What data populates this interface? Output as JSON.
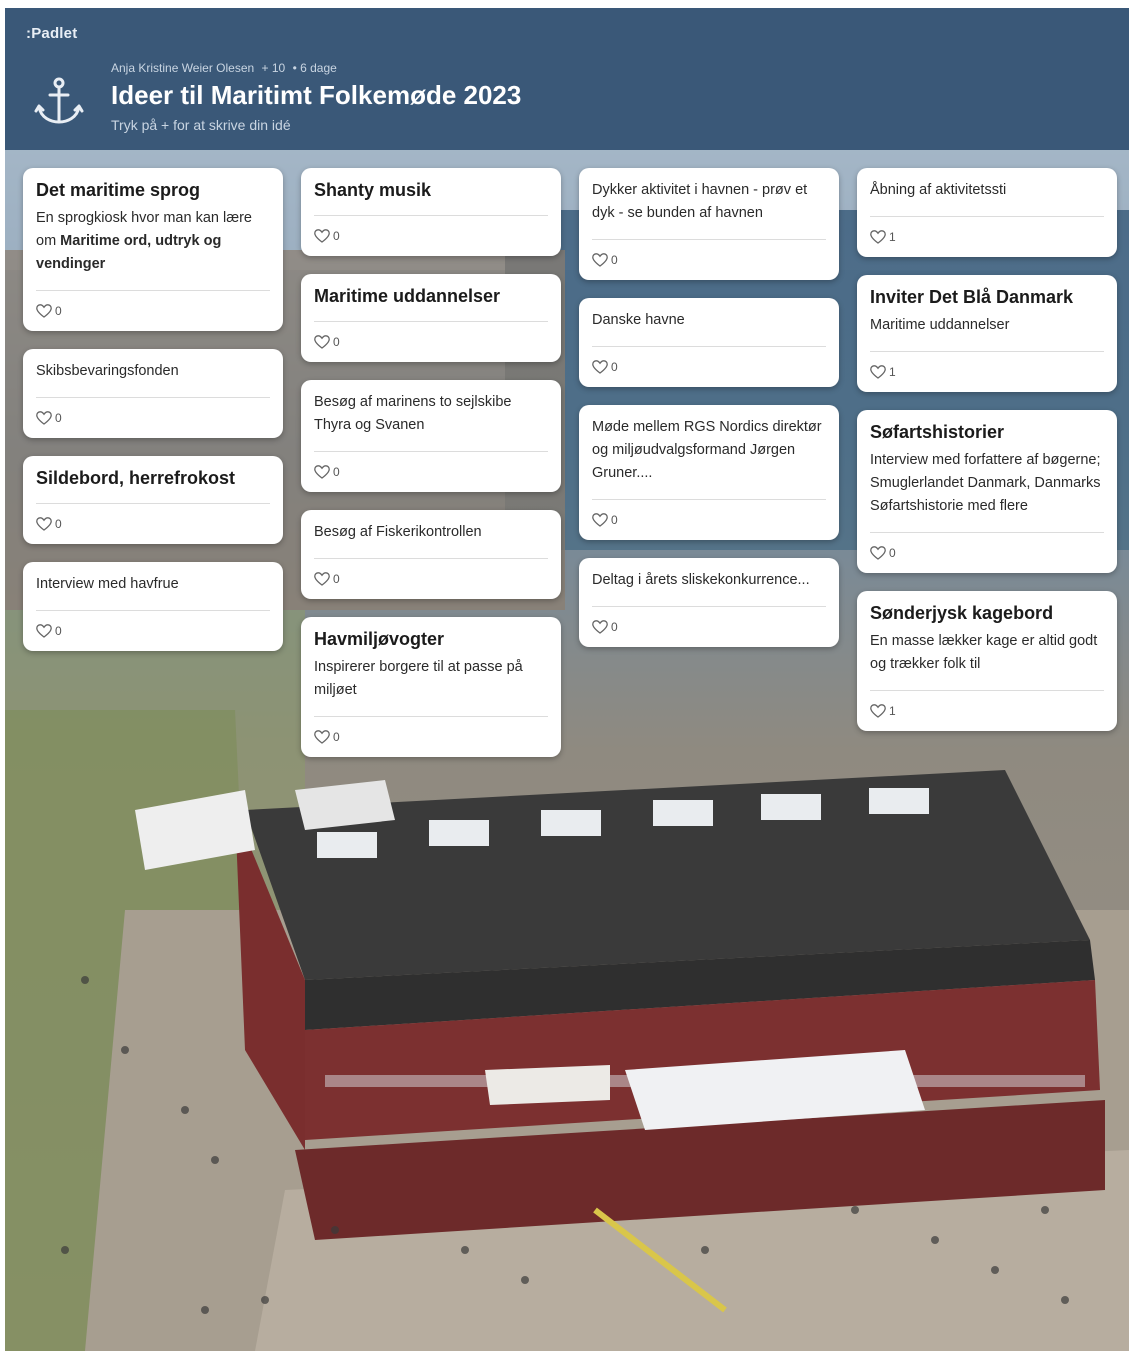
{
  "header": {
    "brand": ":Padlet",
    "author": "Anja Kristine Weier Olesen",
    "contributors": "+ 10",
    "age": "• 6 dage",
    "title": "Ideer til Maritimt Folkemøde 2023",
    "subtitle": "Tryk på + for at skrive din idé",
    "icon": "anchor-icon"
  },
  "columns": [
    [
      {
        "title": "Det maritime sprog",
        "body": [
          {
            "text": "En sprogkiosk hvor man kan lære om "
          },
          {
            "text": "Maritime ord, udtryk og vendinger",
            "bold": true
          }
        ],
        "likes": "0"
      },
      {
        "title": "",
        "body": [
          {
            "text": "Skibsbevaringsfonden"
          }
        ],
        "likes": "0"
      },
      {
        "title": "Sildebord, herrefrokost",
        "body": [],
        "likes": "0"
      },
      {
        "title": "",
        "body": [
          {
            "text": "Interview med havfrue"
          }
        ],
        "likes": "0"
      }
    ],
    [
      {
        "title": "Shanty musik",
        "body": [],
        "likes": "0"
      },
      {
        "title": "Maritime uddannelser",
        "body": [],
        "likes": "0"
      },
      {
        "title": "",
        "body": [
          {
            "text": "Besøg af marinens to sejlskibe Thyra og Svanen"
          }
        ],
        "likes": "0"
      },
      {
        "title": "",
        "body": [
          {
            "text": "Besøg af Fiskerikontrollen"
          }
        ],
        "likes": "0"
      },
      {
        "title": "Havmiljøvogter",
        "body": [
          {
            "text": "Inspirerer borgere til at passe på miljøet"
          }
        ],
        "likes": "0"
      }
    ],
    [
      {
        "title": "",
        "body": [
          {
            "text": "Dykker aktivitet i havnen - prøv et dyk - se bunden af havnen"
          }
        ],
        "likes": "0"
      },
      {
        "title": "",
        "body": [
          {
            "text": "Danske havne"
          }
        ],
        "likes": "0"
      },
      {
        "title": "",
        "body": [
          {
            "text": "Møde mellem RGS Nordics direktør og miljøudvalgsformand Jørgen Gruner...."
          }
        ],
        "likes": "0"
      },
      {
        "title": "",
        "body": [
          {
            "text": "Deltag i årets sliskekonkurrence..."
          }
        ],
        "likes": "0"
      }
    ],
    [
      {
        "title": "",
        "body": [
          {
            "text": "Åbning af aktivitetssti"
          }
        ],
        "likes": "1"
      },
      {
        "title": "Inviter Det Blå Danmark",
        "body": [
          {
            "text": "Maritime uddannelser"
          }
        ],
        "likes": "1"
      },
      {
        "title": "Søfartshistorier",
        "body": [
          {
            "text": "Interview med forfattere af bøgerne; Smuglerlandet Danmark, Danmarks Søfartshistorie med flere"
          }
        ],
        "likes": "0"
      },
      {
        "title": "Sønderjysk kagebord",
        "body": [
          {
            "text": "En masse lækker kage er altid godt og trækker folk til"
          }
        ],
        "likes": "1"
      }
    ]
  ],
  "colors": {
    "header": "#3a5878",
    "card": "#ffffff"
  }
}
